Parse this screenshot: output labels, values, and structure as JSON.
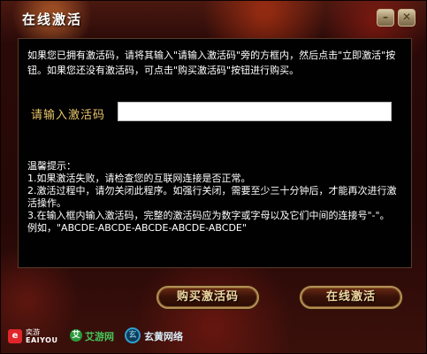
{
  "window": {
    "title": "在线激活",
    "minimize_icon": "minimize-icon",
    "close_icon": "close-icon",
    "minimize_glyph": "–",
    "close_glyph": "✕"
  },
  "instructions": "如果您已拥有激活码，请将其输入\"请输入激活码\"旁的方框内，然后点击\"立即激活\"按钮。如果您还没有激活码，可点击\"购买激活码\"按钮进行购买。",
  "activation": {
    "label": "请输入激活码",
    "value": "",
    "placeholder": ""
  },
  "tips": {
    "heading": "温馨提示：",
    "items": [
      "1.如果激活失败，请检查您的互联网连接是否正常。",
      "2.激活过程中，请勿关闭此程序。如强行关闭，需要至少三十分钟后，才能再次进行激活操作。",
      "3.在输入框内输入激活码，完整的激活码应为数字或字母以及它们中间的连接号\"-\"。",
      "例如，\"ABCDE-ABCDE-ABCDE-ABCDE-ABCDE\""
    ]
  },
  "buttons": {
    "buy": "购买激活码",
    "activate": "在线激活"
  },
  "logos": {
    "eaiyou_cn": "奕游",
    "eaiyou_en": "EAIYOU",
    "eaiyou_glyph": "e",
    "aiyou": "艾游网",
    "aiyou_glyph": "艾",
    "xuanyuan": "玄黄网络",
    "xuanyuan_glyph": "玄"
  },
  "colors": {
    "label_gold": "#e8c66a",
    "button_border": "#b49056",
    "content_bg": "#020101"
  }
}
